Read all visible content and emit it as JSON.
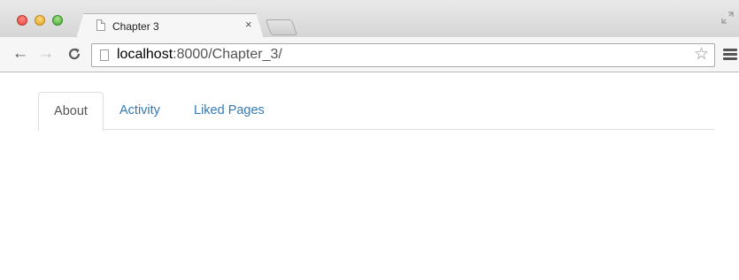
{
  "browser": {
    "tab": {
      "title": "Chapter 3",
      "close_label": "×",
      "icon": "page-icon"
    },
    "toolbar": {
      "back_icon": "←",
      "forward_icon": "→",
      "reload_icon": "C",
      "url_host": "localhost",
      "url_rest": ":8000/Chapter_3/",
      "star_icon": "☆"
    }
  },
  "page": {
    "tabs": [
      {
        "label": "About",
        "active": true
      },
      {
        "label": "Activity",
        "active": false
      },
      {
        "label": "Liked Pages",
        "active": false
      }
    ]
  },
  "colors": {
    "link": "#337ab7",
    "active_tab_text": "#555555",
    "tab_border": "#dddddd"
  }
}
